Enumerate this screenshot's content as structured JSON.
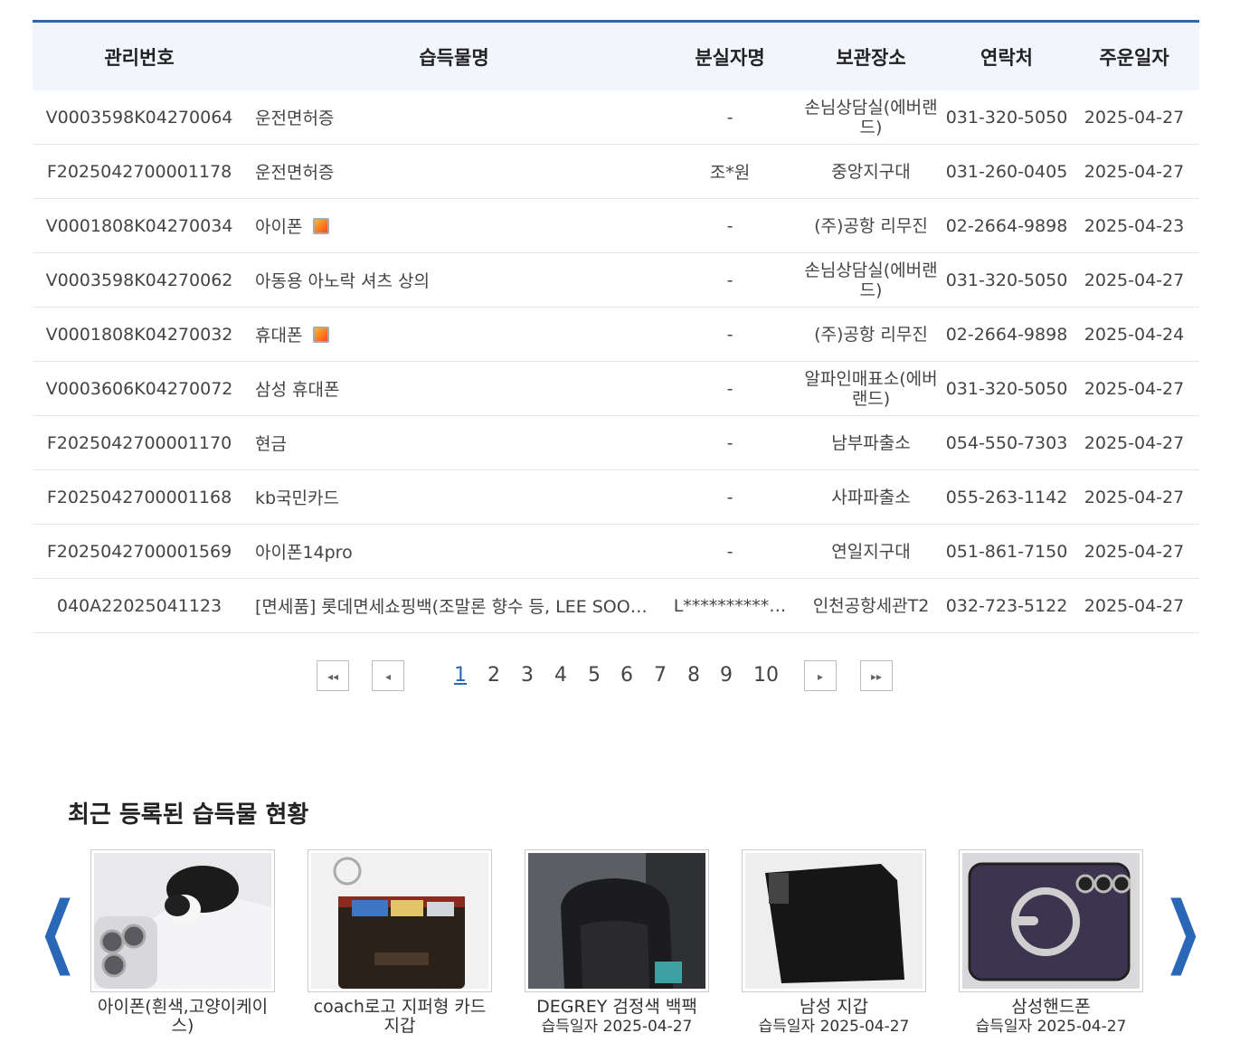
{
  "table": {
    "headers": [
      "관리번호",
      "습득물명",
      "분실자명",
      "보관장소",
      "연락처",
      "주운일자"
    ],
    "rows": [
      {
        "id": "V0003598K04270064",
        "name": "운전면허증",
        "loser": "-",
        "place": "손님상담실(에버랜드)",
        "phone": "031-320-5050",
        "date": "2025-04-27",
        "photo": false
      },
      {
        "id": "F2025042700001178",
        "name": "운전면허증",
        "loser": "조*원",
        "place": "중앙지구대",
        "phone": "031-260-0405",
        "date": "2025-04-27",
        "photo": false
      },
      {
        "id": "V0001808K04270034",
        "name": "아이폰",
        "loser": "-",
        "place": "(주)공항 리무진",
        "phone": "02-2664-9898",
        "date": "2025-04-23",
        "photo": true
      },
      {
        "id": "V0003598K04270062",
        "name": "아동용 아노락 셔츠 상의",
        "loser": "-",
        "place": "손님상담실(에버랜드)",
        "phone": "031-320-5050",
        "date": "2025-04-27",
        "photo": false
      },
      {
        "id": "V0001808K04270032",
        "name": "휴대폰",
        "loser": "-",
        "place": "(주)공항 리무진",
        "phone": "02-2664-9898",
        "date": "2025-04-24",
        "photo": true
      },
      {
        "id": "V0003606K04270072",
        "name": "삼성 휴대폰",
        "loser": "-",
        "place": "알파인매표소(에버랜드)",
        "phone": "031-320-5050",
        "date": "2025-04-27",
        "photo": false
      },
      {
        "id": "F2025042700001170",
        "name": "현금",
        "loser": "-",
        "place": "남부파출소",
        "phone": "054-550-7303",
        "date": "2025-04-27",
        "photo": false
      },
      {
        "id": "F2025042700001168",
        "name": "kb국민카드",
        "loser": "-",
        "place": "사파파출소",
        "phone": "055-263-1142",
        "date": "2025-04-27",
        "photo": false
      },
      {
        "id": "F2025042700001569",
        "name": "아이폰14pro",
        "loser": "-",
        "place": "연일지구대",
        "phone": "051-861-7150",
        "date": "2025-04-27",
        "photo": false
      },
      {
        "id": "040A22025041123",
        "name": "[면세품] 롯데면세쇼핑백(조말론 향수 등, LEE SOO…",
        "loser": "L**********…",
        "place": "인천공항세관T2",
        "phone": "032-723-5122",
        "date": "2025-04-27",
        "photo": false
      }
    ]
  },
  "pagination": {
    "first_icon": "◂◂",
    "prev_icon": "◂",
    "next_icon": "▸",
    "last_icon": "▸▸",
    "pages": [
      "1",
      "2",
      "3",
      "4",
      "5",
      "6",
      "7",
      "8",
      "9",
      "10"
    ],
    "current": "1"
  },
  "recent": {
    "title": "최근 등록된 습득물 현황",
    "prev_arrow": "❮",
    "next_arrow": "❯",
    "items": [
      {
        "name": "아이폰(흰색,고양이케이스)",
        "date": "습득일자 2025-04-27"
      },
      {
        "name": "coach로고 지퍼형 카드지갑",
        "date": "습득일자 2025-04-27"
      },
      {
        "name": "DEGREY 검정색 백팩",
        "date": "습득일자 2025-04-27"
      },
      {
        "name": "남성 지갑",
        "date": "습득일자 2025-04-27"
      },
      {
        "name": "삼성핸드폰",
        "date": "습득일자 2025-04-27"
      }
    ]
  },
  "colors": {
    "accent": "#2a67b7",
    "header_bg": "#f2f6fc"
  }
}
